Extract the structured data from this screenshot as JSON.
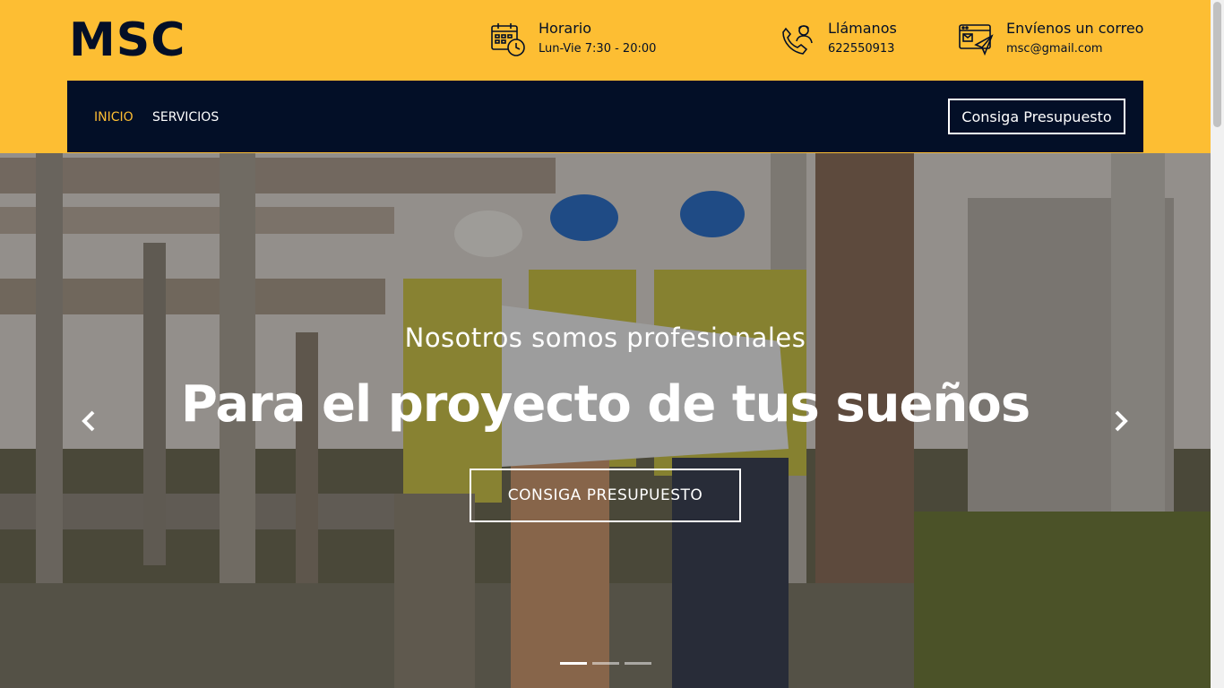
{
  "header": {
    "logo": "MSC",
    "hours": {
      "title": "Horario",
      "value": "Lun-Vie 7:30 - 20:00",
      "icon": "calendar-clock-icon"
    },
    "call": {
      "title": "Llámanos",
      "value": "622550913",
      "icon": "phone-call-icon"
    },
    "mail": {
      "title": "Envíenos un correo",
      "value": "msc@gmail.com",
      "icon": "mail-icon"
    }
  },
  "nav": {
    "items": [
      {
        "label": "INICIO",
        "active": true
      },
      {
        "label": "SERVICIOS",
        "active": false
      }
    ],
    "cta": "Consiga Presupuesto"
  },
  "hero": {
    "subtitle": "Nosotros somos profesionales",
    "title": "Para el proyecto de tus sueños",
    "button": "CONSIGA PRESUPUESTO",
    "slides": 3,
    "active_slide": 1
  },
  "colors": {
    "accent": "#fdbe33",
    "dark": "#030f27",
    "white": "#ffffff"
  }
}
